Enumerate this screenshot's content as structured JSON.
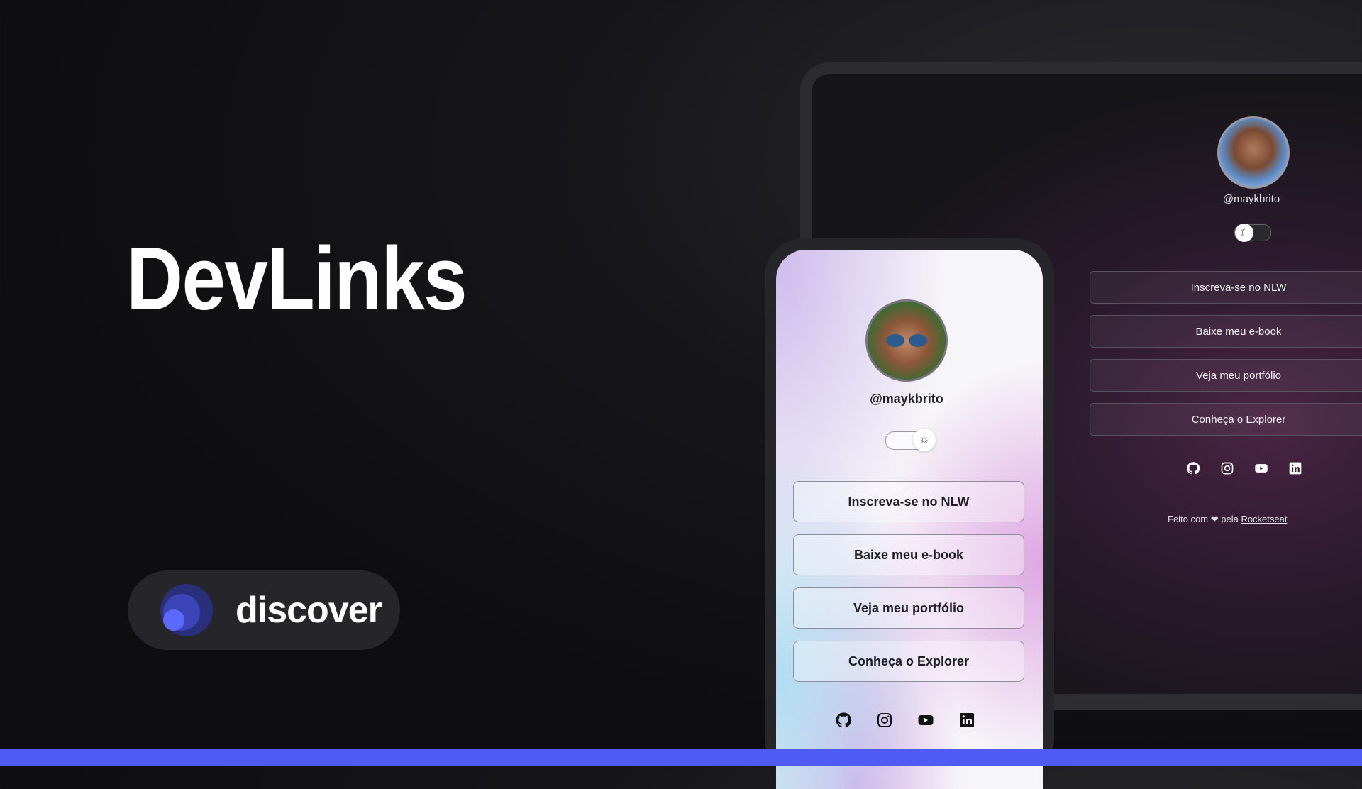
{
  "hero": {
    "title": "DevLinks"
  },
  "badge": {
    "label": "discover"
  },
  "desktop_preview": {
    "username": "@maykbrito",
    "theme_toggle_icon": "moon-icon",
    "buttons": [
      "Inscreva-se no NLW",
      "Baixe meu e-book",
      "Veja meu portfólio",
      "Conheça o Explorer"
    ],
    "socials": [
      "github-icon",
      "instagram-icon",
      "youtube-icon",
      "linkedin-icon"
    ],
    "footer": {
      "prefix": "Feito com",
      "heart": "❤",
      "middle": "pela",
      "link": "Rocketseat"
    }
  },
  "mobile_preview": {
    "username": "@maykbrito",
    "theme_toggle_icon": "sun-icon",
    "buttons": [
      "Inscreva-se no NLW",
      "Baixe meu e-book",
      "Veja meu portfólio",
      "Conheça o Explorer"
    ],
    "socials": [
      "github-icon",
      "instagram-icon",
      "youtube-icon",
      "linkedin-icon"
    ]
  },
  "colors": {
    "accent": "#4f5bf2",
    "background": "#121214",
    "badge_bg": "#26262a"
  }
}
